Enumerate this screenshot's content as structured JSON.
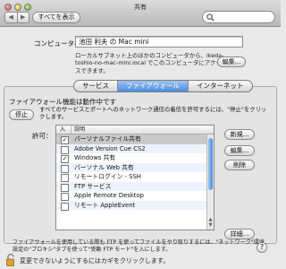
{
  "window": {
    "title": "共有"
  },
  "toolbar": {
    "back_glyph": "◀",
    "forward_glyph": "▶",
    "show_all_label": "すべてを表示",
    "search_placeholder": "",
    "search_icon": "magnifier-icon"
  },
  "computer": {
    "label": "コンピュータ名：",
    "name_value": "池田 利夫 の Mac mini",
    "description": "ローカルサブネット上のほかのコンピュータから、ikeda-toshio-no-mac-mini.local でこのコンピュータにアクセスできます。",
    "edit_label": "編集..."
  },
  "tabs": [
    {
      "label": "サービス",
      "active": false
    },
    {
      "label": "ファイアウォール",
      "active": true
    },
    {
      "label": "インターネット",
      "active": false
    }
  ],
  "firewall": {
    "status": "ファイアウォール機能は動作中です",
    "stop_label": "停止",
    "stop_desc": "すべてのサービスとポートへのネットワーク通信の着信を許可するには、\"停止\"をクリックします。",
    "allow_label": "許可：",
    "columns": {
      "on": "入",
      "desc": "説明"
    },
    "rows": [
      {
        "checked": true,
        "label": "パーソナルファイル共有",
        "selected": true
      },
      {
        "checked": false,
        "label": "Adobe Version Cue CS2",
        "selected": false
      },
      {
        "checked": true,
        "label": "Windows 共有",
        "selected": false
      },
      {
        "checked": false,
        "label": "パーソナル Web 共有",
        "selected": false
      },
      {
        "checked": false,
        "label": "リモートログイン - SSH",
        "selected": false
      },
      {
        "checked": false,
        "label": "FTP サービス",
        "selected": false
      },
      {
        "checked": false,
        "label": "Apple Remote Desktop",
        "selected": false
      },
      {
        "checked": false,
        "label": "リモート AppleEvent",
        "selected": false
      }
    ],
    "new_label": "新規...",
    "edit_label": "編集...",
    "delete_label": "削除",
    "advanced_label": "詳細...",
    "note": "ファイアウォールを使用している際も FTP を使ってファイルをやり取りするには、\"ネットワーク\"環境設定の\"プロキシ\"タブを使って\"受動 FTP モード\"を入にします。"
  },
  "help_glyph": "?",
  "lock": {
    "text": "変更できないようにするにはカギをクリックします。",
    "icon": "lock-open-icon"
  },
  "colors": {
    "accent": "#4f8ee0",
    "selected_row": "#c9c9c9"
  }
}
